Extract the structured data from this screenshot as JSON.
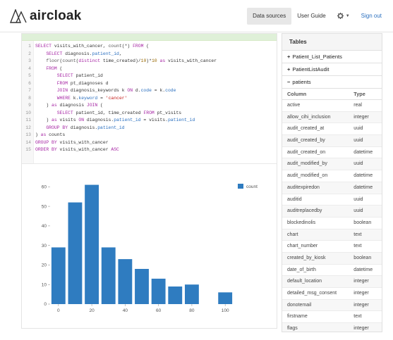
{
  "header": {
    "logo_text": "aircloak",
    "nav": {
      "data_sources": "Data sources",
      "user_guide": "User Guide",
      "sign_out": "Sign out"
    },
    "icons": {
      "logo": "aircloak-logo-icon",
      "settings": "gear-icon",
      "caret": "chevron-down-icon"
    }
  },
  "editor": {
    "lines": [
      {
        "n": "1",
        "html": "<span class=\"kw\">SELECT</span> visits_with_cancer, <span class=\"fn\">count</span>(*) <span class=\"kw\">FROM</span> ("
      },
      {
        "n": "2",
        "html": "    <span class=\"kw\">SELECT</span> diagnosis.<span class=\"ref\">patient_id</span>,"
      },
      {
        "n": "3",
        "html": "    <span class=\"fn\">floor</span>(<span class=\"fn\">count</span>(<span class=\"kw\">distinct</span> time_created)/<span class=\"num\">10</span>)*<span class=\"num\">10</span> <span class=\"kw\">as</span> visits_with_cancer"
      },
      {
        "n": "4",
        "html": "    <span class=\"kw\">FROM</span> ("
      },
      {
        "n": "5",
        "html": "        <span class=\"kw\">SELECT</span> patient_id"
      },
      {
        "n": "6",
        "html": "        <span class=\"kw\">FROM</span> pt_diagnoses d"
      },
      {
        "n": "7",
        "html": "        <span class=\"kw\">JOIN</span> diagnosis_keywords k <span class=\"kw\">ON</span> d.<span class=\"ref\">code</span> = k.<span class=\"ref\">code</span>"
      },
      {
        "n": "8",
        "html": "        <span class=\"kw\">WHERE</span> k.<span class=\"ref\">keyword</span> = <span class=\"str\">'cancer'</span>"
      },
      {
        "n": "9",
        "html": "    ) <span class=\"kw\">as</span> diagnosis <span class=\"kw\">JOIN</span> ("
      },
      {
        "n": "10",
        "html": "        <span class=\"kw\">SELECT</span> patient_id, time_created <span class=\"kw\">FROM</span> pt_visits"
      },
      {
        "n": "11",
        "html": "    ) <span class=\"kw\">as</span> visits <span class=\"kw\">ON</span> diagnosis.<span class=\"ref\">patient_id</span> = visits.<span class=\"ref\">patient_id</span>"
      },
      {
        "n": "12",
        "html": "    <span class=\"kw\">GROUP BY</span> diagnosis.<span class=\"ref\">patient_id</span>"
      },
      {
        "n": "13",
        "html": ") <span class=\"kw\">as</span> counts"
      },
      {
        "n": "14",
        "html": "<span class=\"kw\">GROUP BY</span> visits_with_cancer"
      },
      {
        "n": "15",
        "html": "<span class=\"kw\">ORDER BY</span> visits_with_cancer <span class=\"kw\">ASC</span>"
      }
    ]
  },
  "chart_data": {
    "type": "bar",
    "x": [
      0,
      10,
      20,
      30,
      40,
      50,
      60,
      70,
      80,
      100
    ],
    "series": [
      {
        "name": "count",
        "values": [
          29,
          52,
          61,
          29,
          23,
          18,
          13,
          9,
          10,
          6
        ]
      }
    ],
    "xticks": [
      "0",
      "20",
      "40",
      "60",
      "80",
      "100"
    ],
    "yticks": [
      "0",
      "10",
      "20",
      "30",
      "40",
      "50",
      "60"
    ],
    "xlim": [
      -5,
      105
    ],
    "ylim": [
      0,
      63
    ],
    "grid": false,
    "legend": "top-right",
    "bar_color": "#2f7cc0"
  },
  "sidebar": {
    "title": "Tables",
    "tables": [
      {
        "marker": "+",
        "name": "Patient_List_Patients"
      },
      {
        "marker": "+",
        "name": "PatientListAudit"
      },
      {
        "marker": "−",
        "name": "patients"
      }
    ],
    "columns_header": {
      "name": "Column",
      "type": "Type"
    },
    "columns": [
      {
        "name": "active",
        "type": "real"
      },
      {
        "name": "allow_cihi_inclusion",
        "type": "integer"
      },
      {
        "name": "audit_created_at",
        "type": "uuid"
      },
      {
        "name": "audit_created_by",
        "type": "uuid"
      },
      {
        "name": "audit_created_on",
        "type": "datetime"
      },
      {
        "name": "audit_modified_by",
        "type": "uuid"
      },
      {
        "name": "audit_modified_on",
        "type": "datetime"
      },
      {
        "name": "auditexpiredon",
        "type": "datetime"
      },
      {
        "name": "auditid",
        "type": "uuid"
      },
      {
        "name": "auditreplacedby",
        "type": "uuid"
      },
      {
        "name": "blockedinolis",
        "type": "boolean"
      },
      {
        "name": "chart",
        "type": "text"
      },
      {
        "name": "chart_number",
        "type": "text"
      },
      {
        "name": "created_by_kiosk",
        "type": "boolean"
      },
      {
        "name": "date_of_birth",
        "type": "datetime"
      },
      {
        "name": "default_location",
        "type": "integer"
      },
      {
        "name": "detailed_msg_consent",
        "type": "integer"
      },
      {
        "name": "donotemail",
        "type": "integer"
      },
      {
        "name": "firstname",
        "type": "text"
      },
      {
        "name": "flags",
        "type": "integer"
      }
    ]
  }
}
